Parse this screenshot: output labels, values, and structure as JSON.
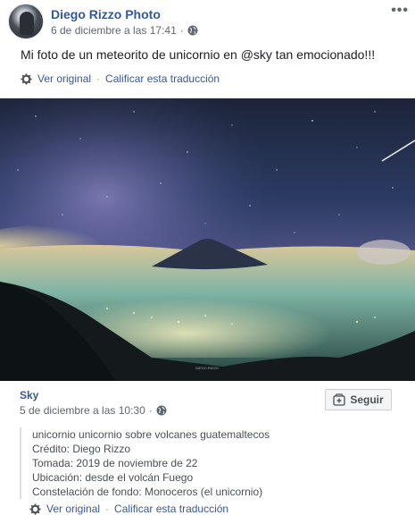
{
  "post": {
    "author": "Diego Rizzo Photo",
    "timestamp": "6 de diciembre a las 17:41",
    "dot": "·",
    "text": "Mi foto de un meteorito de unicornio en @sky tan emocionado!!!",
    "see_original": "Ver original",
    "rate_translation": "Calificar esta traducción"
  },
  "photo": {
    "watermark": "DIEGO RIZZO"
  },
  "shared": {
    "author": "Sky",
    "timestamp": "5 de diciembre a las 10:30",
    "dot": "·",
    "follow_label": "Seguir",
    "lines": [
      "unicornio unicornio sobre volcanes guatemaltecos",
      "Crédito: Diego Rizzo",
      "Tomada: 2019 de noviembre de 22",
      "Ubicación: desde el volcán Fuego",
      "Constelación de fondo: Monoceros (el unicornio)"
    ],
    "see_original": "Ver original",
    "rate_translation": "Calificar esta traducción"
  },
  "icons": {
    "privacy": "globe-icon",
    "translation": "gear-icon",
    "menu": "more-icon",
    "follow": "follow-icon"
  },
  "colors": {
    "link": "#385898",
    "author": "#365899",
    "meta": "#616770"
  }
}
